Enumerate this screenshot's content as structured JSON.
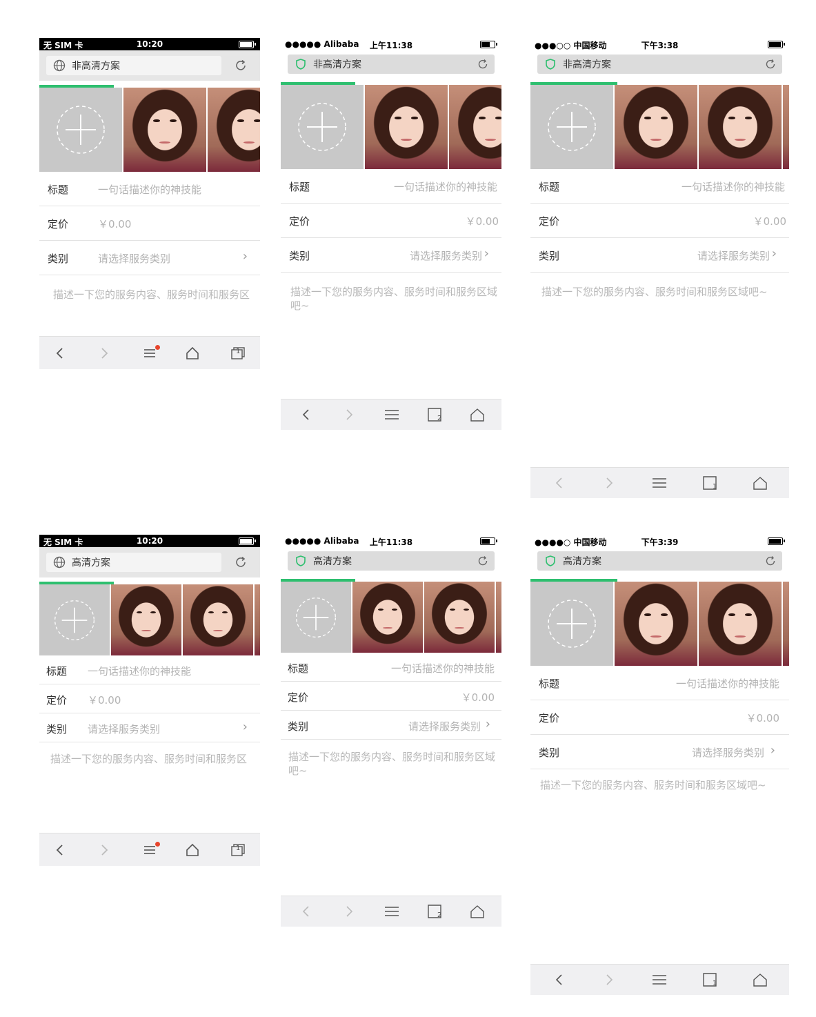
{
  "colors": {
    "accent_green": "#2ebf6f",
    "badge_red": "#e8452c",
    "placeholder_gray": "#b3b3b3"
  },
  "screens": [
    {
      "status": {
        "carrier": "无 SIM 卡",
        "time": "10:20"
      },
      "url_title": "非高清方案",
      "url_icon": "globe-icon",
      "form": {
        "title_label": "标题",
        "title_placeholder": "一句话描述你的神技能",
        "price_label": "定价",
        "price_value": "￥0.00",
        "category_label": "类别",
        "category_placeholder": "请选择服务类别",
        "desc": "描述一下您的服务内容、服务时间和服务区"
      },
      "toolbar": [
        "back-icon",
        "forward-icon",
        "menu-icon",
        "home-icon",
        "tabs-icon"
      ],
      "tabs_count": "1"
    },
    {
      "status": {
        "carrier": "●●●●● Alibaba",
        "time": "上午11:38"
      },
      "url_title": "非高清方案",
      "url_icon": "shield-icon",
      "form": {
        "title_label": "标题",
        "title_placeholder": "一句话描述你的神技能",
        "price_label": "定价",
        "price_value": "￥0.00",
        "category_label": "类别",
        "category_placeholder": "请选择服务类别",
        "desc": "描述一下您的服务内容、服务时间和服务区域吧~"
      },
      "toolbar": [
        "back-icon",
        "forward-icon",
        "menu-icon",
        "tabs-icon",
        "home-icon"
      ],
      "tabs_count": "2"
    },
    {
      "status": {
        "carrier": "●●●○○ 中国移动",
        "time": "下午3:38"
      },
      "url_title": "非高清方案",
      "url_icon": "shield-icon",
      "form": {
        "title_label": "标题",
        "title_placeholder": "一句话描述你的神技能",
        "price_label": "定价",
        "price_value": "￥0.00",
        "category_label": "类别",
        "category_placeholder": "请选择服务类别",
        "desc": "描述一下您的服务内容、服务时间和服务区域吧~"
      },
      "toolbar": [
        "back-icon",
        "forward-icon",
        "menu-icon",
        "tabs-icon",
        "home-icon"
      ],
      "tabs_count": "1"
    },
    {
      "status": {
        "carrier": "无 SIM 卡",
        "time": "10:20"
      },
      "url_title": "高清方案",
      "url_icon": "globe-icon",
      "form": {
        "title_label": "标题",
        "title_placeholder": "一句话描述你的神技能",
        "price_label": "定价",
        "price_value": "￥0.00",
        "category_label": "类别",
        "category_placeholder": "请选择服务类别",
        "desc": "描述一下您的服务内容、服务时间和服务区"
      },
      "toolbar": [
        "back-icon",
        "forward-icon",
        "menu-icon",
        "home-icon",
        "tabs-icon"
      ],
      "tabs_count": "1"
    },
    {
      "status": {
        "carrier": "●●●●● Alibaba",
        "time": "上午11:38"
      },
      "url_title": "高清方案",
      "url_icon": "shield-icon",
      "form": {
        "title_label": "标题",
        "title_placeholder": "一句话描述你的神技能",
        "price_label": "定价",
        "price_value": "￥0.00",
        "category_label": "类别",
        "category_placeholder": "请选择服务类别",
        "desc": "描述一下您的服务内容、服务时间和服务区域吧~"
      },
      "toolbar": [
        "back-icon",
        "forward-icon",
        "menu-icon",
        "tabs-icon",
        "home-icon"
      ],
      "tabs_count": "2"
    },
    {
      "status": {
        "carrier": "●●●●○ 中国移动",
        "time": "下午3:39"
      },
      "url_title": "高清方案",
      "url_icon": "shield-icon",
      "form": {
        "title_label": "标题",
        "title_placeholder": "一句话描述你的神技能",
        "price_label": "定价",
        "price_value": "￥0.00",
        "category_label": "类别",
        "category_placeholder": "请选择服务类别",
        "desc": "描述一下您的服务内容、服务时间和服务区域吧~"
      },
      "toolbar": [
        "back-icon",
        "forward-icon",
        "menu-icon",
        "tabs-icon",
        "home-icon"
      ],
      "tabs_count": "1"
    }
  ]
}
